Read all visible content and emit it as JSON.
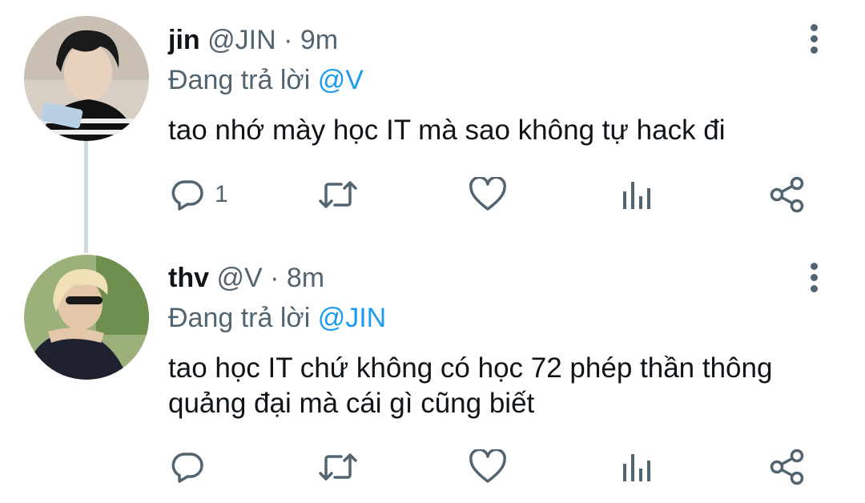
{
  "colors": {
    "text": "#0f1419",
    "secondary": "#536471",
    "mention": "#1d9bf0",
    "thread_line": "#cfd9de",
    "background": "#ffffff"
  },
  "tweets": [
    {
      "display_name": "jin",
      "handle": "@JIN",
      "separator": "·",
      "time": "9m",
      "replying_label": "Đang trả lời",
      "replying_to": "@V",
      "text": "tao nhớ mày học IT mà sao không tự hack đi",
      "reply_count": "1",
      "icons": [
        "reply-icon",
        "retweet-icon",
        "like-icon",
        "analytics-icon",
        "share-icon",
        "more-options-icon"
      ]
    },
    {
      "display_name": "thv",
      "handle": "@V",
      "separator": "·",
      "time": "8m",
      "replying_label": "Đang trả lời",
      "replying_to": "@JIN",
      "text_line1": "tao học IT chứ không có học 72 phép thần thông",
      "text_line2": "quảng đại mà cái gì cũng biết",
      "reply_count": "",
      "icons": [
        "reply-icon",
        "retweet-icon",
        "like-icon",
        "analytics-icon",
        "share-icon",
        "more-options-icon"
      ]
    }
  ]
}
